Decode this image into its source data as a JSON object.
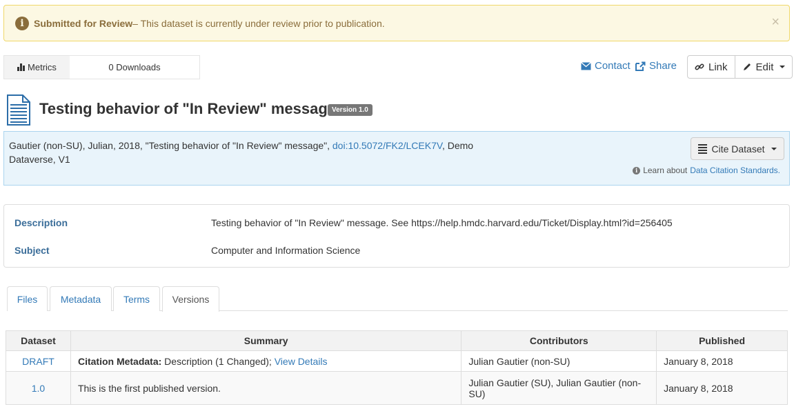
{
  "alert": {
    "title": "Submitted for Review",
    "message": " – This dataset is currently under review prior to publication.",
    "close": "×"
  },
  "metrics": {
    "label": "Metrics",
    "downloads": "0 Downloads"
  },
  "actions": {
    "contact": "Contact",
    "share": "Share",
    "link": "Link",
    "edit": "Edit"
  },
  "dataset": {
    "title": "Testing behavior of \"In Review\" message",
    "version_badge": "Version 1.0"
  },
  "citation": {
    "text_before": "Gautier (non-SU), Julian, 2018, \"Testing behavior of \"In Review\" message\", ",
    "doi": "doi:10.5072/FK2/LCEK7V",
    "text_after": ", Demo Dataverse, V1",
    "cite_button": "Cite Dataset",
    "learn_prefix": "Learn about ",
    "learn_link": "Data Citation Standards."
  },
  "summary": {
    "description_label": "Description",
    "description_value": "Testing behavior of \"In Review\" message. See https://help.hmdc.harvard.edu/Ticket/Display.html?id=256405",
    "subject_label": "Subject",
    "subject_value": "Computer and Information Science"
  },
  "tabs": [
    {
      "label": "Files"
    },
    {
      "label": "Metadata"
    },
    {
      "label": "Terms"
    },
    {
      "label": "Versions"
    }
  ],
  "versions_table": {
    "headers": [
      "Dataset",
      "Summary",
      "Contributors",
      "Published"
    ],
    "rows": [
      {
        "dataset": "DRAFT",
        "summary_bold": "Citation Metadata:",
        "summary_text": " Description (1 Changed); ",
        "summary_link": "View Details",
        "contributors": "Julian Gautier (non-SU)",
        "published": "January 8, 2018"
      },
      {
        "dataset": "1.0",
        "summary_text": "This is the first published version.",
        "contributors": "Julian Gautier (SU), Julian Gautier (non-SU)",
        "published": "January 8, 2018"
      }
    ]
  }
}
